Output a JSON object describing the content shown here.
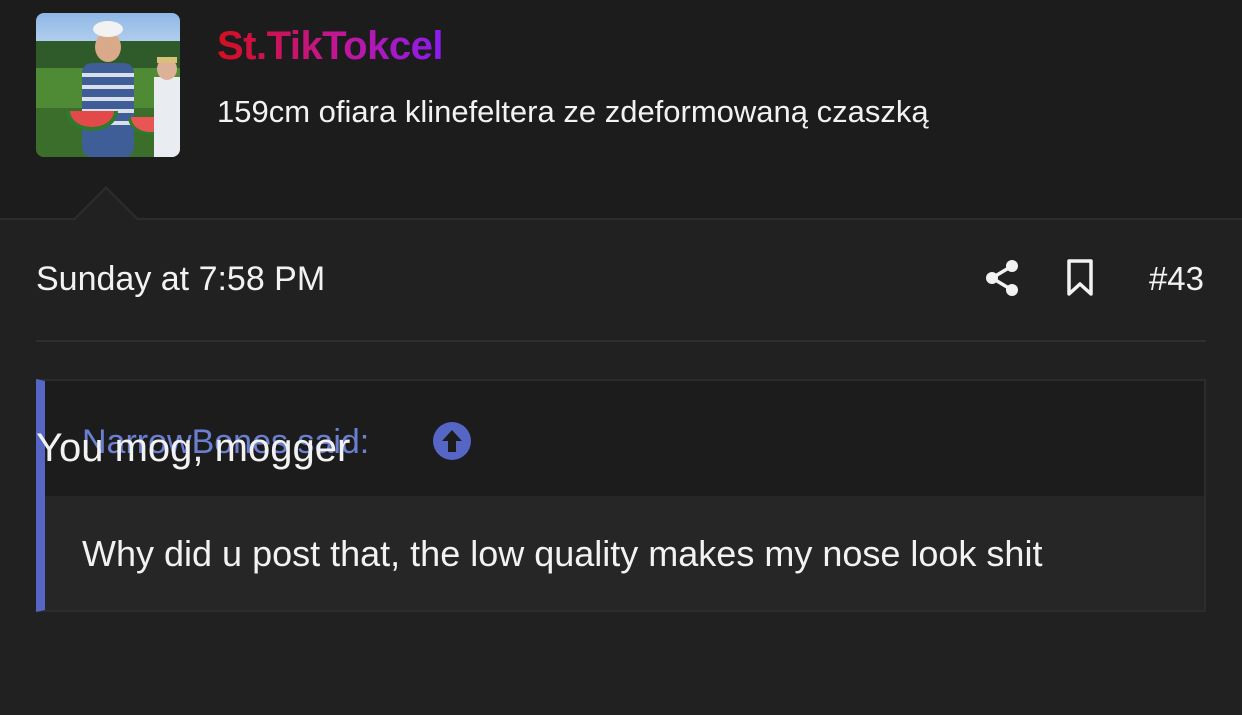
{
  "user": {
    "username": "St.TikTokcel",
    "title": "159cm ofiara klinefeltera ze zdeformowaną czaszką",
    "avatar_icon": "user-avatar-photo",
    "username_gradient": [
      "#d40f1f",
      "#c0179b",
      "#8a1cf0"
    ]
  },
  "post": {
    "date": "Sunday at 7:58 PM",
    "number": "#43",
    "share_icon": "share-icon",
    "bookmark_icon": "bookmark-icon",
    "quote": {
      "author_label": "NarrowBones said:",
      "jump_icon": "arrow-up-circle-icon",
      "text": "Why did u post that, the low quality makes my nose look shit",
      "accent_color": "#5666c4"
    },
    "message": "You mog, mogger"
  }
}
